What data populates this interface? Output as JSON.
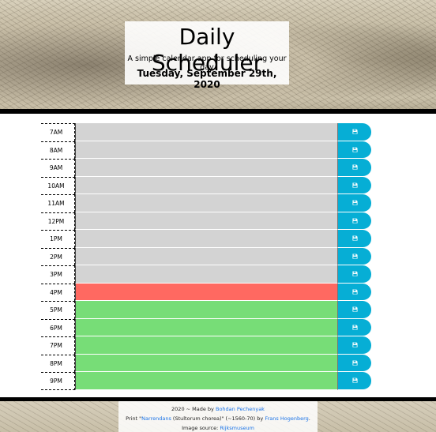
{
  "header": {
    "title": "Daily Scheduler",
    "subtitle": "A simple calendar app for scheduling your day",
    "date": "Tuesday, September 29th, 2020"
  },
  "rows": [
    {
      "hour": "7AM",
      "state": "past",
      "text": ""
    },
    {
      "hour": "8AM",
      "state": "past",
      "text": ""
    },
    {
      "hour": "9AM",
      "state": "past",
      "text": ""
    },
    {
      "hour": "10AM",
      "state": "past",
      "text": ""
    },
    {
      "hour": "11AM",
      "state": "past",
      "text": ""
    },
    {
      "hour": "12PM",
      "state": "past",
      "text": ""
    },
    {
      "hour": "1PM",
      "state": "past",
      "text": ""
    },
    {
      "hour": "2PM",
      "state": "past",
      "text": ""
    },
    {
      "hour": "3PM",
      "state": "past",
      "text": ""
    },
    {
      "hour": "4PM",
      "state": "present",
      "text": ""
    },
    {
      "hour": "5PM",
      "state": "future",
      "text": ""
    },
    {
      "hour": "6PM",
      "state": "future",
      "text": ""
    },
    {
      "hour": "7PM",
      "state": "future",
      "text": ""
    },
    {
      "hour": "8PM",
      "state": "future",
      "text": ""
    },
    {
      "hour": "9PM",
      "state": "future",
      "text": ""
    }
  ],
  "save_icon": "save-icon",
  "colors": {
    "past": "#d3d3d3",
    "present": "#ff6961",
    "future": "#77dd77",
    "save_button": "#06aed5"
  },
  "footer": {
    "line1_prefix": "2020 ~ Made by",
    "line1_author": "Bohdan Pechenyak",
    "line2_prefix": "Print \"",
    "line2_link": "Narrendans",
    "line2_middle": " (Stultorum chorea)\" (~1560-70) by",
    "line2_artist": "Frans Hogenberg",
    "line2_suffix": ".",
    "line3_prefix": "Image source:",
    "line3_link": "Rijksmuseum"
  }
}
